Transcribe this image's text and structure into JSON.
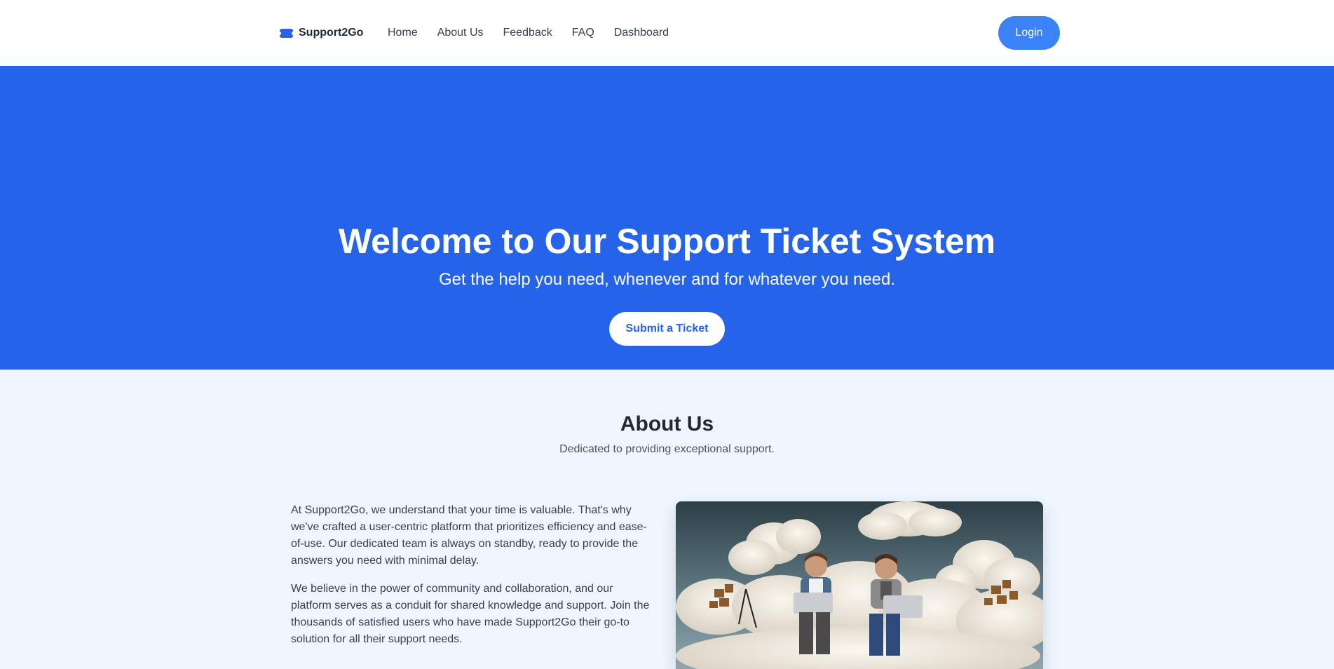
{
  "brand": {
    "name": "Support2Go",
    "icon": "ticket-icon",
    "accent_color": "#2563eb"
  },
  "nav": {
    "items": [
      {
        "label": "Home"
      },
      {
        "label": "About Us"
      },
      {
        "label": "Feedback"
      },
      {
        "label": "FAQ"
      },
      {
        "label": "Dashboard"
      }
    ],
    "login_label": "Login"
  },
  "hero": {
    "title": "Welcome to Our Support Ticket System",
    "subtitle": "Get the help you need, whenever and for whatever you need.",
    "cta_label": "Submit a Ticket",
    "background_color": "#2563eb"
  },
  "about": {
    "title": "About Us",
    "subtitle": "Dedicated to providing exceptional support.",
    "paragraphs": [
      "At Support2Go, we understand that your time is valuable. That's why we've crafted a user-centric platform that prioritizes efficiency and ease-of-use. Our dedicated team is always on standby, ready to provide the answers you need with minimal delay.",
      "We believe in the power of community and collaboration, and our platform serves as a conduit for shared knowledge and support. Join the thousands of satisfied users who have made Support2Go their go-to solution for all their support needs."
    ]
  }
}
